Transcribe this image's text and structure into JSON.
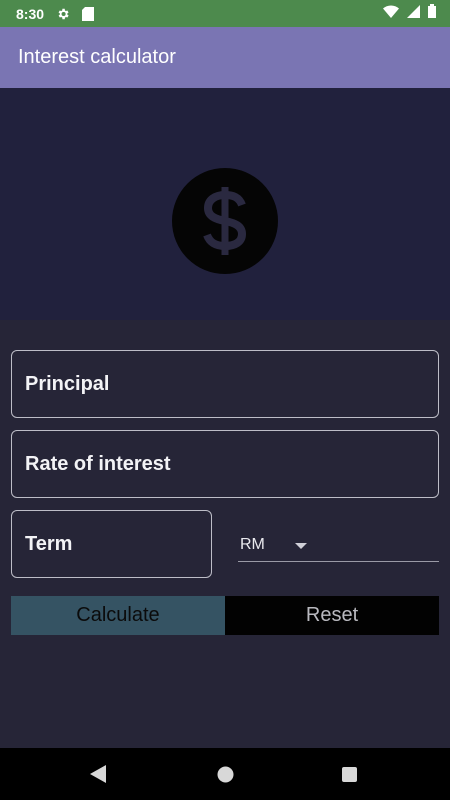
{
  "status_bar": {
    "time": "8:30",
    "icons": [
      "gear-icon",
      "sd-card-icon",
      "wifi-icon",
      "signal-icon",
      "battery-icon"
    ],
    "color": "#4d8a4d"
  },
  "app_bar": {
    "title": "Interest calculator",
    "color": "#7a75b3"
  },
  "hero": {
    "icon": "dollar-coin-icon"
  },
  "form": {
    "principal_label": "Principal",
    "rate_label": "Rate of interest",
    "term_label": "Term",
    "currency_selected": "RM"
  },
  "buttons": {
    "calculate_label": "Calculate",
    "reset_label": "Reset",
    "calculate_color": "#355363",
    "reset_color": "#020202"
  },
  "nav_bar": {
    "icons": [
      "back-icon",
      "home-icon",
      "recents-icon"
    ]
  }
}
